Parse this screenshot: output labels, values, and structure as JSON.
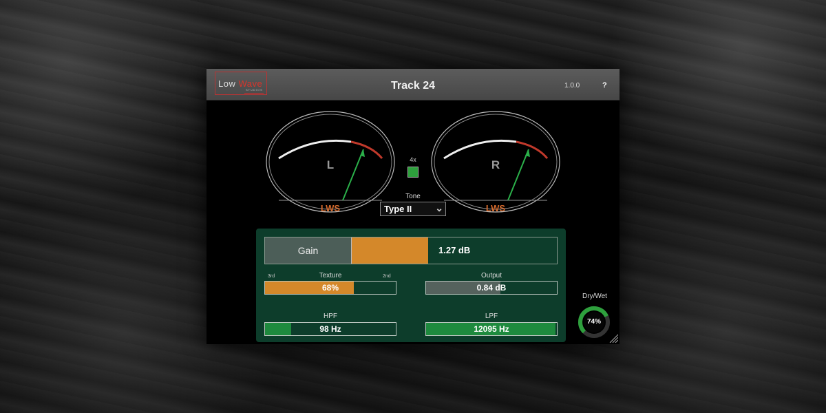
{
  "header": {
    "logo_text_low": "Low ",
    "logo_text_wave": "Wave",
    "logo_sub": "STUDIOS",
    "title": "Track 24",
    "version": "1.0.0",
    "help_label": "?"
  },
  "meters": [
    {
      "channel": "L",
      "brand": "LWS"
    },
    {
      "channel": "R",
      "brand": "LWS"
    }
  ],
  "oversample": {
    "label": "4x",
    "enabled": true
  },
  "tone": {
    "label": "Tone",
    "selected": "Type II"
  },
  "gain": {
    "label": "Gain",
    "value_text": "1.27 dB",
    "level": 0.37
  },
  "texture": {
    "label": "Texture",
    "left_label": "3rd",
    "right_label": "2nd",
    "value_text": "68%",
    "level": 0.68
  },
  "output": {
    "label": "Output",
    "value_text": "0.84 dB",
    "level": 0.57
  },
  "hpf": {
    "label": "HPF",
    "value_text": "98 Hz",
    "level": 0.2
  },
  "lpf": {
    "label": "LPF",
    "value_text": "12095 Hz",
    "level": 0.99
  },
  "drywet": {
    "label": "Dry/Wet",
    "value_text": "74%",
    "level": 0.74
  },
  "colors": {
    "accent_orange": "#d4882a",
    "accent_green": "#2ea03d",
    "panel_green": "#0d3d2b",
    "needle_green": "#2bb04a",
    "red_zone": "#c0392b"
  }
}
